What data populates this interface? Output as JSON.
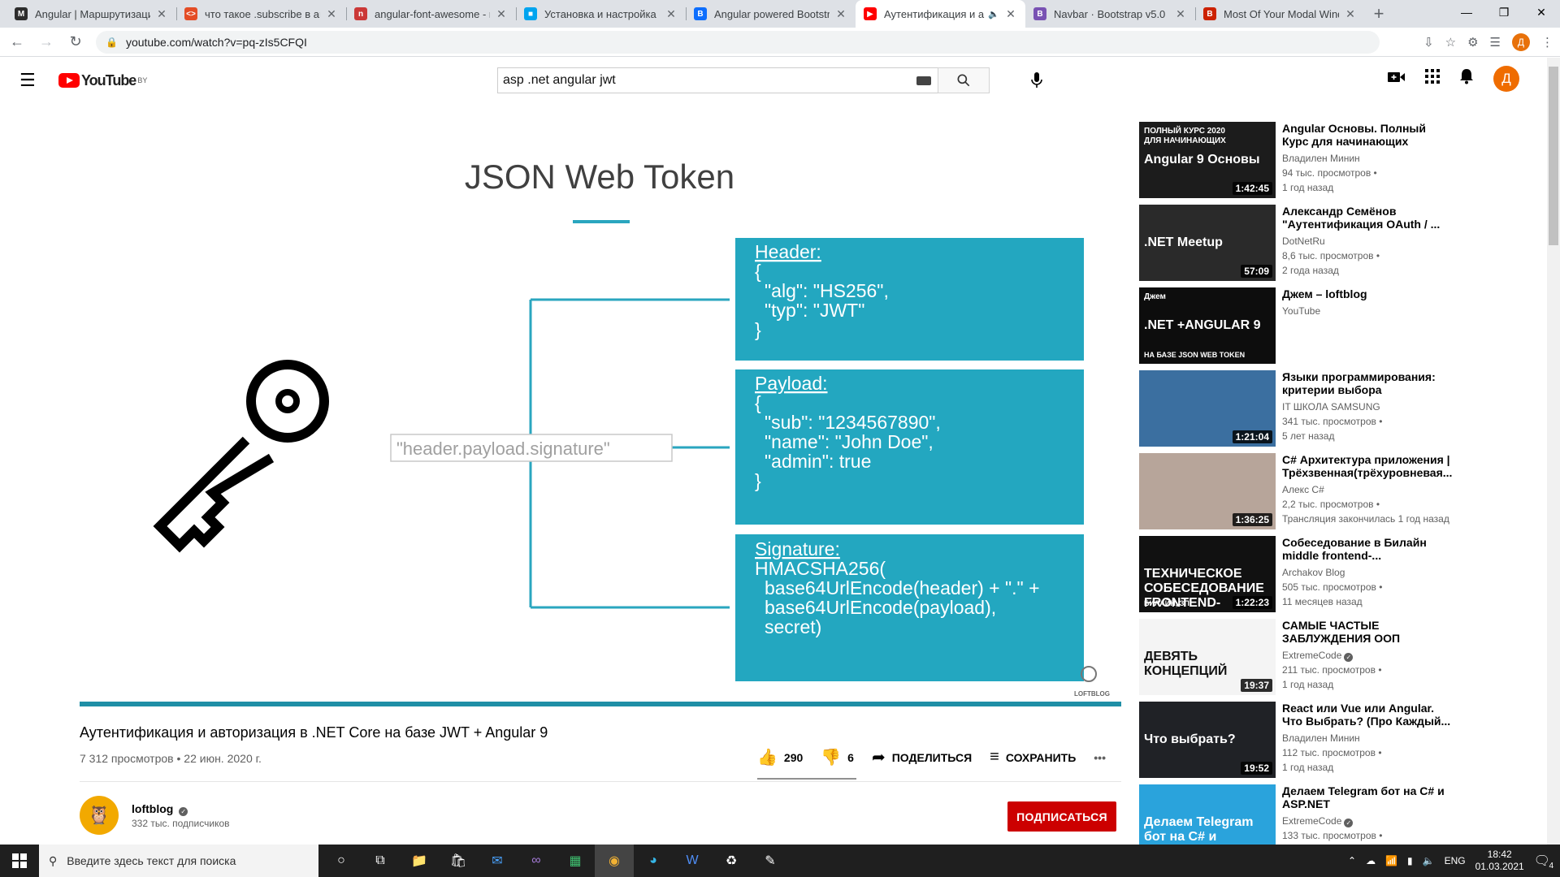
{
  "browser": {
    "tabs": [
      {
        "title": "Angular | Маршрутизация",
        "fav_bg": "#2d2d2d",
        "fav_text": "M"
      },
      {
        "title": "что такое .subscribe в angular",
        "fav_bg": "#e44d26",
        "fav_text": "<>"
      },
      {
        "title": "angular-font-awesome - npm",
        "fav_bg": "#cb3837",
        "fav_text": "n"
      },
      {
        "title": "Установка и настройка сервера",
        "fav_bg": "#00a4ef",
        "fav_text": "■"
      },
      {
        "title": "Angular powered Bootstrap",
        "fav_bg": "#0d6efd",
        "fav_text": "B"
      },
      {
        "title": "Аутентификация и автори",
        "fav_bg": "#ff0000",
        "fav_text": "▶",
        "active": true,
        "audio": "🔈"
      },
      {
        "title": "Navbar · Bootstrap v5.0",
        "fav_bg": "#7952b3",
        "fav_text": "B"
      },
      {
        "title": "Most Of Your Modal Window",
        "fav_bg": "#cc2200",
        "fav_text": "B"
      }
    ],
    "new_tab": "+",
    "url": "youtube.com/watch?v=pq-zIs5CFQI",
    "profile_initial": "Д"
  },
  "youtube": {
    "region": "BY",
    "logo_text": "YouTube",
    "search_value": "asp .net angular jwt",
    "avatar_initial": "Д"
  },
  "video": {
    "slide_title": "JSON Web Token",
    "format_label": "\"header.payload.signature\"",
    "header_box": [
      "Header:",
      "{",
      "  \"alg\": \"HS256\",",
      "  \"typ\": \"JWT\"",
      "}"
    ],
    "payload_box": [
      "Payload:",
      "{",
      "  \"sub\": \"1234567890\",",
      "  \"name\": \"John Doe\",",
      "  \"admin\": true",
      "}"
    ],
    "signature_box": [
      "Signature:",
      "HMACSHA256(",
      "  base64UrlEncode(header) + \".\" +",
      "  base64UrlEncode(payload),",
      "  secret)"
    ],
    "watermark": "LOFTBLOG",
    "accent": "#23a7c0",
    "title": "Аутентификация и авторизация в .NET Core на базе JWT + Angular 9",
    "views": "7 312 просмотров",
    "date": "22 июн. 2020 г.",
    "likes": "290",
    "dislikes": "6",
    "share": "ПОДЕЛИТЬСЯ",
    "save": "СОХРАНИТЬ",
    "more": "•••",
    "channel": "loftblog",
    "subscribers": "332 тыс. подписчиков",
    "subscribe": "ПОДПИСАТЬСЯ"
  },
  "recommendations": [
    {
      "title": "Angular Основы. Полный Курс для начинающих",
      "channel": "Владилен Минин",
      "views": "94 тыс. просмотров •",
      "age": "1 год назад",
      "duration": "1:42:45",
      "thumb": "#1c1c1c",
      "thumb_text": "Angular 9 Основы",
      "thumb_top": "ПОЛНЫЙ КУРС 2020 ДЛЯ НАЧИНАЮЩИХ",
      "verified": false
    },
    {
      "title": "Александр Семёнов \"Аутентификация OAuth / ...",
      "channel": "DotNetRu",
      "views": "8,6 тыс. просмотров •",
      "age": "2 года назад",
      "duration": "57:09",
      "thumb": "#2a2a2a",
      "thumb_text": ".NET Meetup",
      "verified": false
    },
    {
      "title": "Джем – loftblog",
      "channel": "YouTube",
      "views": "",
      "age": "",
      "duration": "",
      "thumb": "#0d0d0d",
      "thumb_text": ".NET +ANGULAR 9",
      "thumb_top": "Джем",
      "thumb_bottom": "НА БАЗЕ JSON WEB TOKEN",
      "verified": false
    },
    {
      "title": "Языки программирования: критерии выбора",
      "channel": "IT ШКОЛА SAMSUNG",
      "views": "341 тыс. просмотров •",
      "age": "5 лет назад",
      "duration": "1:21:04",
      "thumb": "#3b6fa0",
      "thumb_text": "",
      "verified": false
    },
    {
      "title": "C# Архитектура приложения | Трёхзвенная(трёхуровневая...",
      "channel": "Алекс C#",
      "views": "2,2 тыс. просмотров •",
      "age": "Трансляция закончилась 1 год назад",
      "duration": "1:36:25",
      "thumb": "#b7a59a",
      "thumb_text": "",
      "verified": false
    },
    {
      "title": "Собеседование в Билайн middle frontend-...",
      "channel": "Archakov Blog",
      "views": "505 тыс. просмотров •",
      "age": "11 месяцев назад",
      "duration": "1:22:23",
      "thumb": "#111111",
      "thumb_text": "ТЕХНИЧЕСКОЕ СОБЕСЕДОВАНИЕ FRONTEND-РАЗРАБОТЧИКОМ",
      "thumb_bottom": "БИЛАЙН, ЗП",
      "verified": false
    },
    {
      "title": "САМЫЕ ЧАСТЫЕ ЗАБЛУЖДЕНИЯ ООП",
      "channel": "ExtremeCode",
      "views": "211 тыс. просмотров •",
      "age": "1 год назад",
      "duration": "19:37",
      "thumb": "#f4f4f4",
      "thumb_text": "ДЕВЯТЬ КОНЦЕПЦИЙ",
      "verified": true
    },
    {
      "title": "React или Vue или Angular. Что Выбрать? (Про Каждый...",
      "channel": "Владилен Минин",
      "views": "112 тыс. просмотров •",
      "age": "1 год назад",
      "duration": "19:52",
      "thumb": "#202226",
      "thumb_text": "Что выбрать?",
      "verified": false
    },
    {
      "title": "Делаем Telegram бот на C# и ASP.NET",
      "channel": "ExtremeCode",
      "views": "133 тыс. просмотров •",
      "age": "",
      "duration": "",
      "thumb": "#2aa3dc",
      "thumb_text": "Делаем Telegram бот на C# и ASP.NET",
      "verified": true
    }
  ],
  "taskbar": {
    "search_placeholder": "Введите здесь текст для поиска",
    "lang": "ENG",
    "time": "18:42",
    "date": "01.03.2021",
    "notifications": "4"
  }
}
